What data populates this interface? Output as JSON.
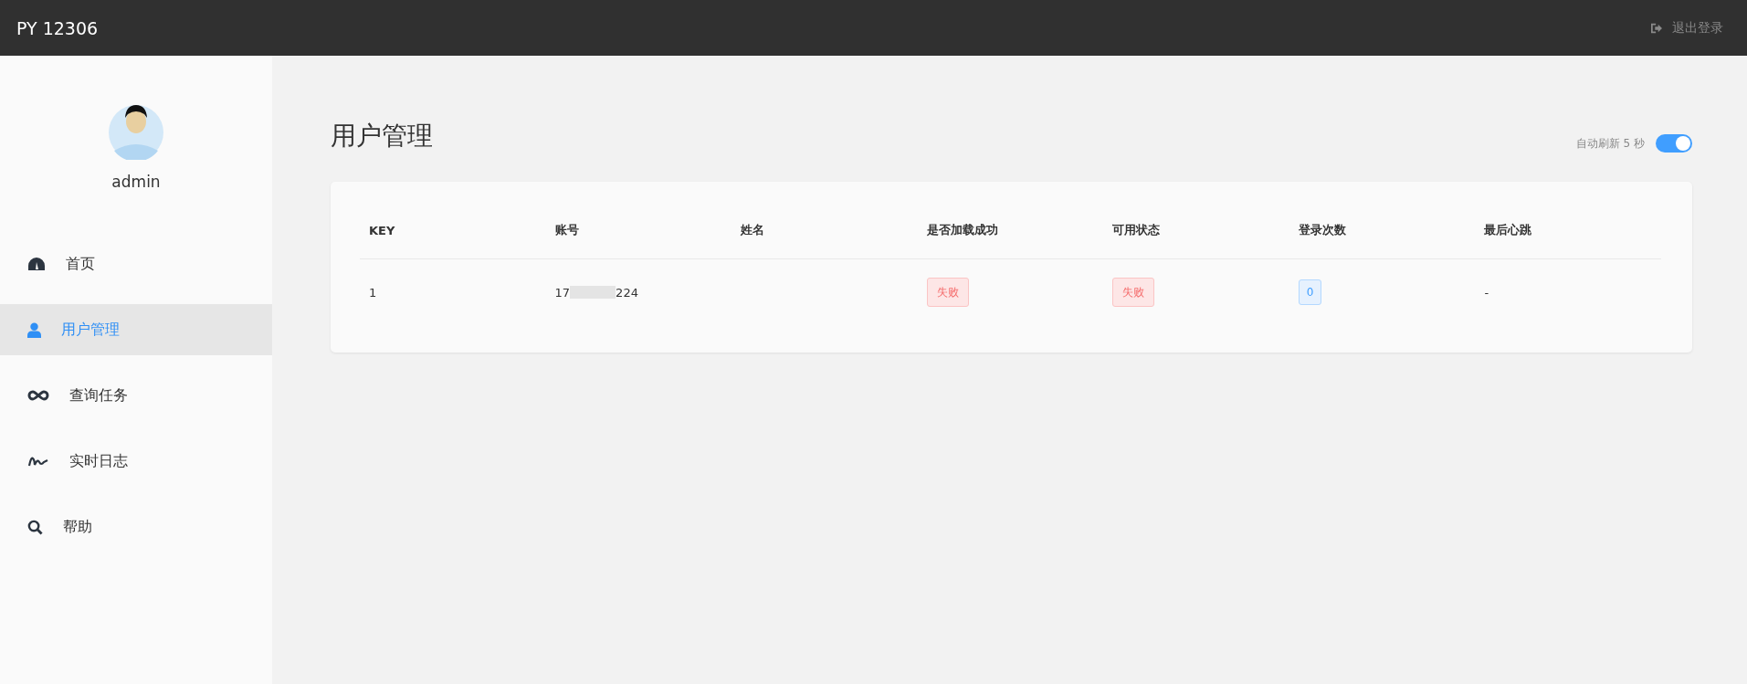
{
  "header": {
    "brand": "PY 12306",
    "logout": "退出登录"
  },
  "sidebar": {
    "user": "admin",
    "items": [
      {
        "label": "首页",
        "kind": "gauge",
        "selected": false
      },
      {
        "label": "用户管理",
        "kind": "user",
        "selected": true
      },
      {
        "label": "查询任务",
        "kind": "infinity",
        "selected": false
      },
      {
        "label": "实时日志",
        "kind": "signature",
        "selected": false
      },
      {
        "label": "帮助",
        "kind": "search",
        "selected": false
      }
    ]
  },
  "page": {
    "title": "用户管理",
    "auto_refresh": {
      "label": "自动刷新 5 秒",
      "on": true
    }
  },
  "table": {
    "columns": [
      "KEY",
      "账号",
      "姓名",
      "是否加载成功",
      "可用状态",
      "登录次数",
      "最后心跳"
    ],
    "rows": [
      {
        "cells": [
          {
            "kind": "text",
            "text": "1"
          },
          {
            "kind": "redacted",
            "start": "17",
            "end": "224"
          },
          {
            "kind": "empty"
          },
          {
            "kind": "danger",
            "text": "失败"
          },
          {
            "kind": "danger",
            "text": "失败"
          },
          {
            "kind": "primary",
            "text": "0"
          },
          {
            "kind": "text",
            "text": "-"
          }
        ]
      }
    ]
  }
}
